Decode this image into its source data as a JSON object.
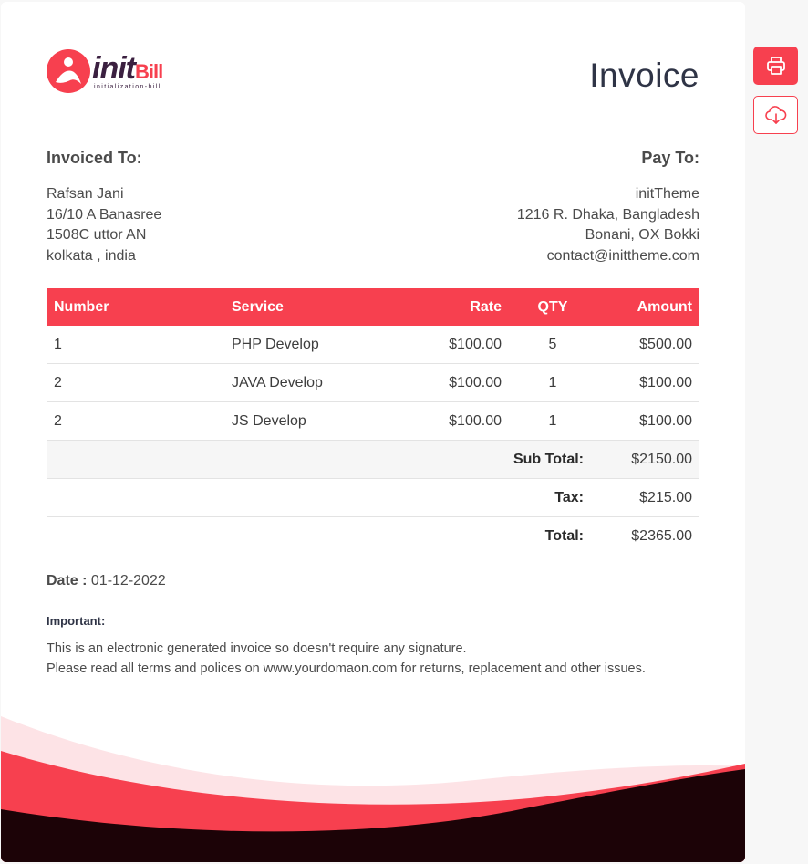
{
  "brand": {
    "name_part1": "init",
    "name_part2": "Bill",
    "tagline": "initialization-bill",
    "accent_color": "#f7404f",
    "dark_color": "#1c0307"
  },
  "document": {
    "title": "Invoice"
  },
  "invoiced_to": {
    "heading": "Invoiced To:",
    "lines": [
      "Rafsan Jani",
      "16/10 A Banasree",
      "1508C uttor AN",
      "kolkata , india"
    ]
  },
  "pay_to": {
    "heading": "Pay To:",
    "lines": [
      "initTheme",
      "1216 R. Dhaka, Bangladesh",
      "Bonani, OX Bokki",
      "contact@inittheme.com"
    ]
  },
  "table": {
    "headers": [
      "Number",
      "Service",
      "Rate",
      "QTY",
      "Amount"
    ],
    "rows": [
      [
        "1",
        "PHP Develop",
        "$100.00",
        "5",
        "$500.00"
      ],
      [
        "2",
        "JAVA Develop",
        "$100.00",
        "1",
        "$100.00"
      ],
      [
        "2",
        "JS Develop",
        "$100.00",
        "1",
        "$100.00"
      ]
    ],
    "subtotal_label": "Sub Total:",
    "subtotal_value": "$2150.00",
    "tax_label": "Tax:",
    "tax_value": "$215.00",
    "total_label": "Total:",
    "total_value": "$2365.00"
  },
  "date": {
    "label": "Date :",
    "value": "01-12-2022"
  },
  "important": {
    "heading": "Important:",
    "lines": [
      "This is an electronic generated invoice so doesn't require any signature.",
      "Please read all terms and polices on www.yourdomaon.com for returns, replacement and other issues."
    ]
  },
  "actions": {
    "print_icon": "printer-icon",
    "download_icon": "cloud-download-icon"
  }
}
